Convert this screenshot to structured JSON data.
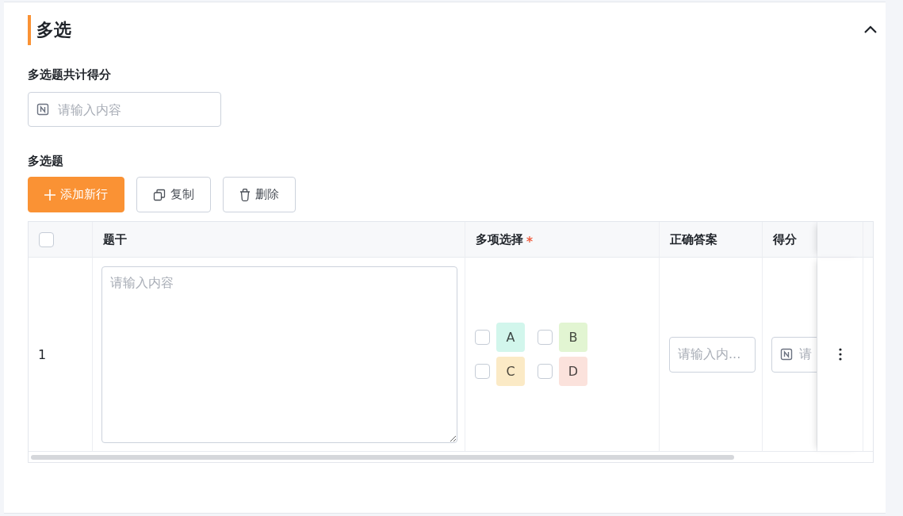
{
  "section": {
    "title": "多选",
    "expanded": true
  },
  "total_score": {
    "label": "多选题共计得分",
    "placeholder": "请输入内容"
  },
  "questions": {
    "label": "多选题",
    "buttons": [
      {
        "kind": "add",
        "label": "添加新行"
      },
      {
        "kind": "copy",
        "label": "复制"
      },
      {
        "kind": "delete",
        "label": "删除"
      }
    ],
    "table": {
      "select_all": {
        "checked": false
      },
      "columns": [
        {
          "label": "题干",
          "required": false
        },
        {
          "label": "多项选择",
          "required": true
        },
        {
          "label": "正确答案",
          "required": false
        },
        {
          "label": "得分",
          "required": false
        }
      ],
      "rows": [
        {
          "index": "1",
          "stem_placeholder": "请输入内容",
          "options": [
            {
              "label": "A",
              "checked": false,
              "color": "#d2f6ec"
            },
            {
              "label": "B",
              "checked": false,
              "color": "#e2f5d2"
            },
            {
              "label": "C",
              "checked": false,
              "color": "#fbeac6"
            },
            {
              "label": "D",
              "checked": false,
              "color": "#fbe2dc"
            }
          ],
          "answer_placeholder": "请输入内...",
          "score_placeholder": "请"
        }
      ]
    }
  }
}
